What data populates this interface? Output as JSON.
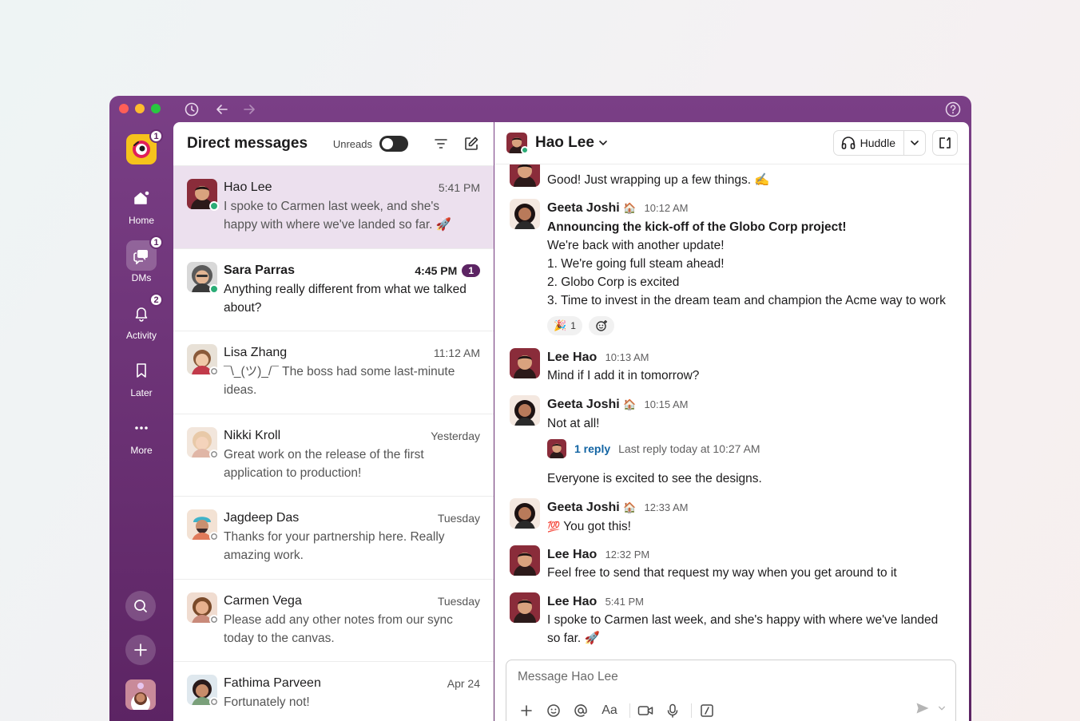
{
  "titlebar": {
    "icons": [
      "history-icon",
      "back-arrow-icon",
      "forward-arrow-icon",
      "help-icon"
    ]
  },
  "rail": {
    "workspace_badge": "1",
    "items": [
      {
        "label": "Home",
        "icon": "home-icon"
      },
      {
        "label": "DMs",
        "icon": "dms-icon",
        "badge": "1"
      },
      {
        "label": "Activity",
        "icon": "bell-icon",
        "badge": "2"
      },
      {
        "label": "Later",
        "icon": "bookmark-icon"
      },
      {
        "label": "More",
        "icon": "more-icon"
      }
    ]
  },
  "dm_panel": {
    "title": "Direct messages",
    "unreads_label": "Unreads",
    "rows": [
      {
        "name": "Hao Lee",
        "time": "5:41 PM",
        "preview": "I spoke to Carmen last week, and she's happy with where we've landed so far. 🚀",
        "online": true,
        "unread": false
      },
      {
        "name": "Sara Parras",
        "time": "4:45 PM",
        "count": "1",
        "preview": "Anything really different from what we talked about?",
        "online": true,
        "unread": true
      },
      {
        "name": "Lisa Zhang",
        "time": "11:12 AM",
        "preview": "¯\\_(ツ)_/¯ The boss had some last-minute ideas.",
        "online": false,
        "unread": false
      },
      {
        "name": "Nikki Kroll",
        "time": "Yesterday",
        "preview": "Great work on the release of the first application to production!",
        "online": false,
        "unread": false
      },
      {
        "name": "Jagdeep Das",
        "time": "Tuesday",
        "preview": "Thanks for your partnership here. Really amazing work.",
        "online": false,
        "unread": false
      },
      {
        "name": "Carmen Vega",
        "time": "Tuesday",
        "preview": "Please add any other notes from our sync today to the canvas.",
        "online": false,
        "unread": false
      },
      {
        "name": "Fathima Parveen",
        "time": "Apr 24",
        "preview": "Fortunately not!",
        "online": false,
        "unread": false
      }
    ]
  },
  "chat": {
    "title": "Hao Lee",
    "huddle_label": "Huddle",
    "messages": {
      "m0": {
        "text": "Good! Just wrapping up a few things. ✍"
      },
      "m1": {
        "name": "Geeta Joshi",
        "status": "🏠",
        "time": "10:12 AM",
        "lines": [
          "Announcing the kick-off of the Globo Corp project!",
          "We're back with another update!",
          "1. We're going full steam ahead!",
          "2. Globo Corp is excited",
          "3. Time to invest in the dream team and champion the Acme way to work"
        ],
        "reaction_emoji": "🎉",
        "reaction_count": "1"
      },
      "m2": {
        "name": "Lee Hao",
        "time": "10:13 AM",
        "text": "Mind if I add it in tomorrow?"
      },
      "m3": {
        "name": "Geeta Joshi",
        "status": "🏠",
        "time": "10:15 AM",
        "text": "Not at all!",
        "thread_count": "1 reply",
        "thread_last": "Last reply today at 10:27 AM",
        "extra": "Everyone is excited to see the designs."
      },
      "m4": {
        "name": "Geeta Joshi",
        "status": "🏠",
        "time": "12:33 AM",
        "emoji": "💯",
        "text": "You got this!"
      },
      "m5": {
        "name": "Lee Hao",
        "time": "12:32 PM",
        "text": "Feel free to send that request my way when you get around to it"
      },
      "m6": {
        "name": "Lee Hao",
        "time": "5:41 PM",
        "text": "I spoke to Carmen last week, and she's happy with where we've landed so far. 🚀"
      }
    },
    "composer": {
      "placeholder": "Message Hao Lee",
      "format_label": "Aa"
    }
  },
  "colors": {
    "accent": "#5c2463",
    "selected_row": "#ece0ee",
    "link": "#1264a3",
    "online": "#2bac76"
  }
}
